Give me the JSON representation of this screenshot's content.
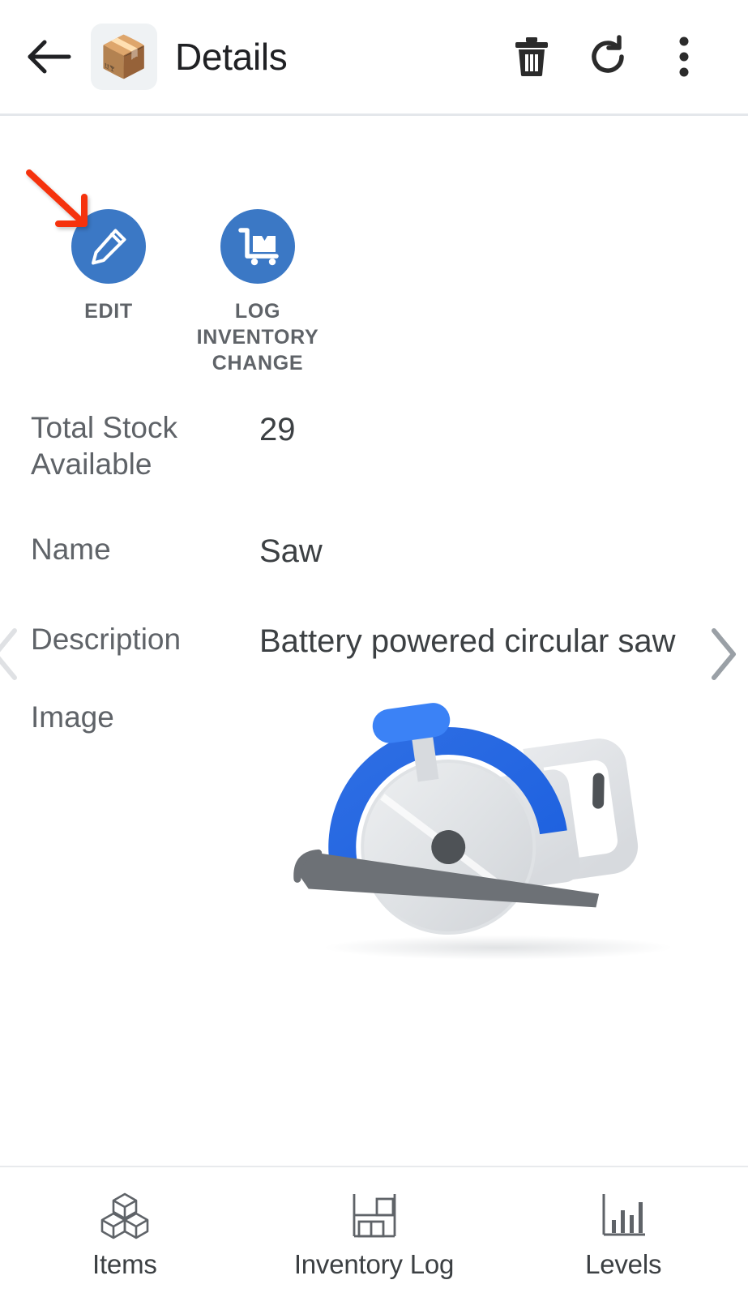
{
  "header": {
    "back_icon": "back-arrow-icon",
    "app_icon": "package-box-emoji",
    "app_icon_glyph": "📦",
    "title": "Details",
    "actions": [
      {
        "name": "delete",
        "icon": "trash-icon"
      },
      {
        "name": "refresh",
        "icon": "refresh-icon"
      },
      {
        "name": "more",
        "icon": "more-vertical-icon"
      }
    ]
  },
  "quick_actions": [
    {
      "label": "EDIT",
      "icon": "pencil-icon",
      "color": "#3b78c5"
    },
    {
      "label": "LOG INVENTORY CHANGE",
      "icon": "hand-truck-box-icon",
      "color": "#3b78c5"
    }
  ],
  "annotation": {
    "type": "arrow",
    "color": "#f5330c",
    "points_to": "EDIT"
  },
  "fields": [
    {
      "label": "Total Stock Available",
      "value": "29"
    },
    {
      "label": "Name",
      "value": "Saw"
    },
    {
      "label": "Description",
      "value": "Battery powered circular saw"
    },
    {
      "label": "Image",
      "value": ""
    }
  ],
  "record_nav": {
    "prev_icon": "chevron-left-icon",
    "next_icon": "chevron-right-icon"
  },
  "image_field": {
    "alt": "blue circular saw illustration"
  },
  "bottom_nav": [
    {
      "label": "Items",
      "icon": "cubes-icon"
    },
    {
      "label": "Inventory Log",
      "icon": "shelf-rack-icon"
    },
    {
      "label": "Levels",
      "icon": "bar-chart-icon"
    }
  ],
  "colors": {
    "accent": "#3b78c5",
    "label_text": "#5f6368",
    "value_text": "#3c4043",
    "annotation": "#f5330c",
    "divider": "#e4e7eb"
  }
}
